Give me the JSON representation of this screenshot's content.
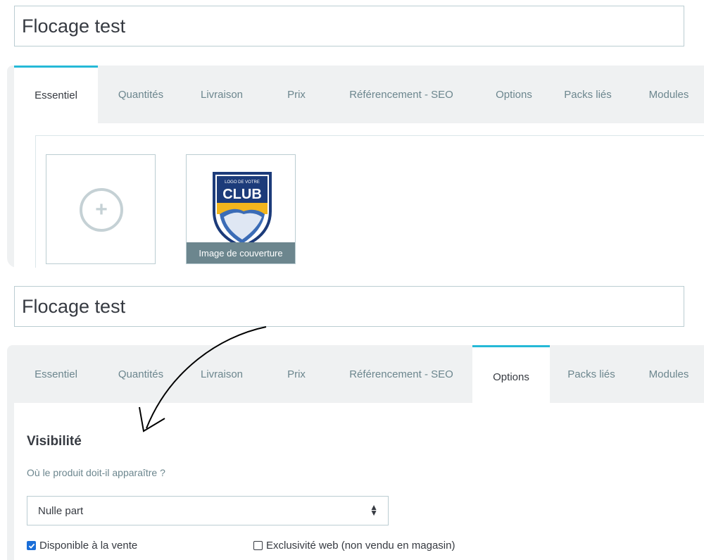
{
  "product_name_1": "Flocage test",
  "product_name_2": "Flocage test",
  "tabs": [
    "Essentiel",
    "Quantités",
    "Livraison",
    "Prix",
    "Référencement - SEO",
    "Options",
    "Packs liés",
    "Modules"
  ],
  "tabs_top_active": "Essentiel",
  "tabs_bottom_active": "Options",
  "images": {
    "cover_label": "Image de couverture",
    "logo_top_text": "LOGO DE VOTRE",
    "logo_main_text": "CLUB",
    "add_icon": "plus-circle-icon"
  },
  "options": {
    "section_title": "Visibilité",
    "question": "Où le produit doit-il apparaître ?",
    "visibility_value": "Nulle part",
    "available_for_sale_label": "Disponible à la vente",
    "available_for_sale_checked": true,
    "web_only_label": "Exclusivité web (non vendu en magasin)",
    "web_only_checked": false
  },
  "colors": {
    "accent": "#25b9d7",
    "text_muted": "#6c868e",
    "text": "#363a41",
    "tab_bg": "#eff1f2",
    "checkbox": "#1a6ed8"
  }
}
